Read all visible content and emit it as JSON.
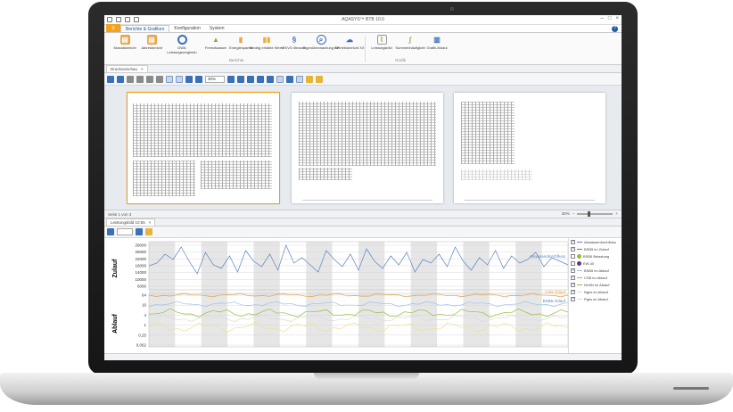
{
  "app": {
    "title": "AQASYS™ BTB 10.0"
  },
  "ribbon": {
    "file_tab": "≡",
    "tabs": [
      "Berichte & Grafiken",
      "Konfiguration",
      "System"
    ],
    "buttons": [
      {
        "label": "Monatsbericht",
        "icon": "report-icon"
      },
      {
        "label": "Jahresbericht",
        "icon": "report-icon"
      },
      {
        "label": "DWA Leistungsvergleich",
        "icon": "circle-icon"
      },
      {
        "label": "Fremdwasser",
        "icon": "triangle-icon"
      },
      {
        "label": "Energiesparen",
        "icon": "battery-icon"
      },
      {
        "label": "Niedrig erklärte Werte",
        "icon": "bottles-icon"
      },
      {
        "label": "EKVO Messen",
        "icon": "paragraph-icon"
      },
      {
        "label": "Eigenüberwachung KF",
        "icon": "search-chart-icon"
      },
      {
        "label": "Betriebsbericht XX",
        "icon": "cloud-icon"
      },
      {
        "label": "Leistungsbild",
        "icon": "chart-icon"
      },
      {
        "label": "Summenhäufigkeit",
        "icon": "curve-icon"
      },
      {
        "label": "Grafik-Modul",
        "icon": "bar-chart-icon"
      }
    ],
    "groups": [
      "Berichte",
      "Grafik"
    ]
  },
  "print_preview": {
    "tab_label": "Druckvorschau",
    "zoom": "30%",
    "status_left": "Seite 1 von 3",
    "status_zoom": "30%"
  },
  "chart_panel": {
    "tab_label": "Leistungsbild 10:55"
  },
  "chart_data": {
    "type": "line",
    "panels": [
      {
        "ylabel": "Zulauf",
        "yticks": [
          "29000",
          "26000",
          "22000",
          "18000",
          "14000",
          "10000",
          "6000"
        ],
        "series": [
          {
            "name": "Abwasserdurchfluss",
            "color": "#5b84c4",
            "values": [
              17500,
              19000,
              24000,
              21000,
              28000,
              20000,
              13000,
              25000,
              18000,
              16000,
              23000,
              14000,
              26000,
              20000,
              17000,
              24000,
              15000,
              29000,
              19000,
              22000,
              18000,
              14000,
              26000,
              21000,
              17000,
              24000,
              15000,
              27000,
              20000,
              16000,
              23000,
              18000,
              25000,
              14000,
              21000,
              19000,
              24000,
              17000,
              28000,
              20000,
              15000,
              22000,
              18000,
              26000,
              16000,
              23000,
              19000,
              21000,
              25000,
              17000,
              22000,
              20000,
              18000
            ]
          }
        ],
        "annotation": "Abwasserdurchfluss"
      },
      {
        "ylabel": "Ablauf",
        "yticks": [
          "64",
          "16",
          "4",
          "1",
          "0,25",
          "0,062"
        ],
        "annotations": [
          "CSB Ablauf",
          "BSB5 Ablauf"
        ]
      }
    ],
    "legend": [
      {
        "label": "Abwasserdurchfluss",
        "checked": true,
        "color": "#5b84c4",
        "marker": "line"
      },
      {
        "label": "BSB5 im Zulauf",
        "checked": true,
        "color": "#c0504d",
        "marker": "line"
      },
      {
        "label": "BSB5 Belastung",
        "checked": false,
        "color": "#8fbf3f",
        "marker": "dot"
      },
      {
        "label": "EW-40",
        "checked": false,
        "color": "#5a3b8c",
        "marker": "dot"
      },
      {
        "label": "BSB5 im Ablauf",
        "checked": true,
        "color": "#9cc3e6",
        "marker": "line"
      },
      {
        "label": "CSB im Ablauf",
        "checked": true,
        "color": "#e8a040",
        "marker": "line"
      },
      {
        "label": "NH4N im Ablauf",
        "checked": true,
        "color": "#8fbf3f",
        "marker": "line"
      },
      {
        "label": "Nges im Ablauf",
        "checked": true,
        "color": "#d9d9d9",
        "marker": "line"
      },
      {
        "label": "Pges im Ablauf",
        "checked": true,
        "color": "#f0e08a",
        "marker": "line"
      }
    ]
  }
}
